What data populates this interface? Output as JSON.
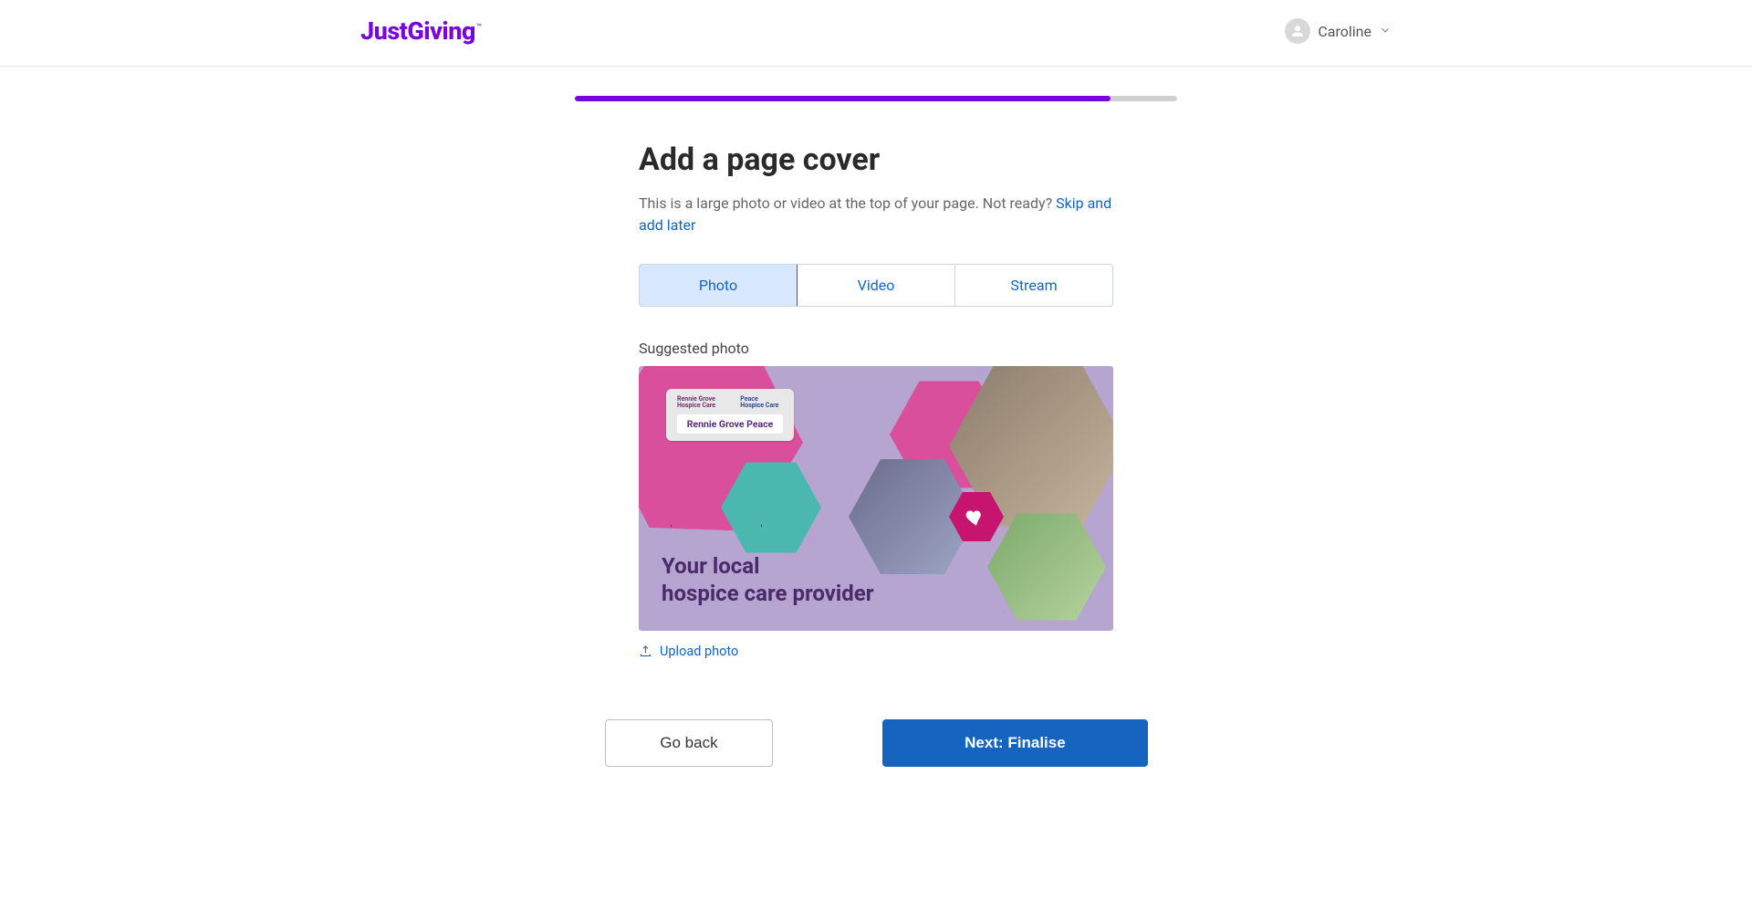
{
  "header": {
    "logo_just": "Just",
    "logo_giving": "Giving",
    "logo_tm": "™",
    "username": "Caroline"
  },
  "progress": {
    "percent": 89
  },
  "page": {
    "title": "Add a page cover",
    "description_prefix": "This is a large photo or video at the top of your page. Not ready? ",
    "skip_link": "Skip and add later"
  },
  "tabs": {
    "photo": "Photo",
    "video": "Video",
    "stream": "Stream",
    "active": "photo"
  },
  "suggested": {
    "label": "Suggested photo",
    "badge_logo1": "Rennie Grove Hospice Care",
    "badge_logo2": "Peace Hospice Care",
    "badge_name": "Rennie Grove Peace",
    "tagline_line1": "Your local",
    "tagline_line2": "hospice care provider"
  },
  "upload": {
    "label": "Upload photo"
  },
  "buttons": {
    "back": "Go back",
    "next": "Next: Finalise"
  }
}
